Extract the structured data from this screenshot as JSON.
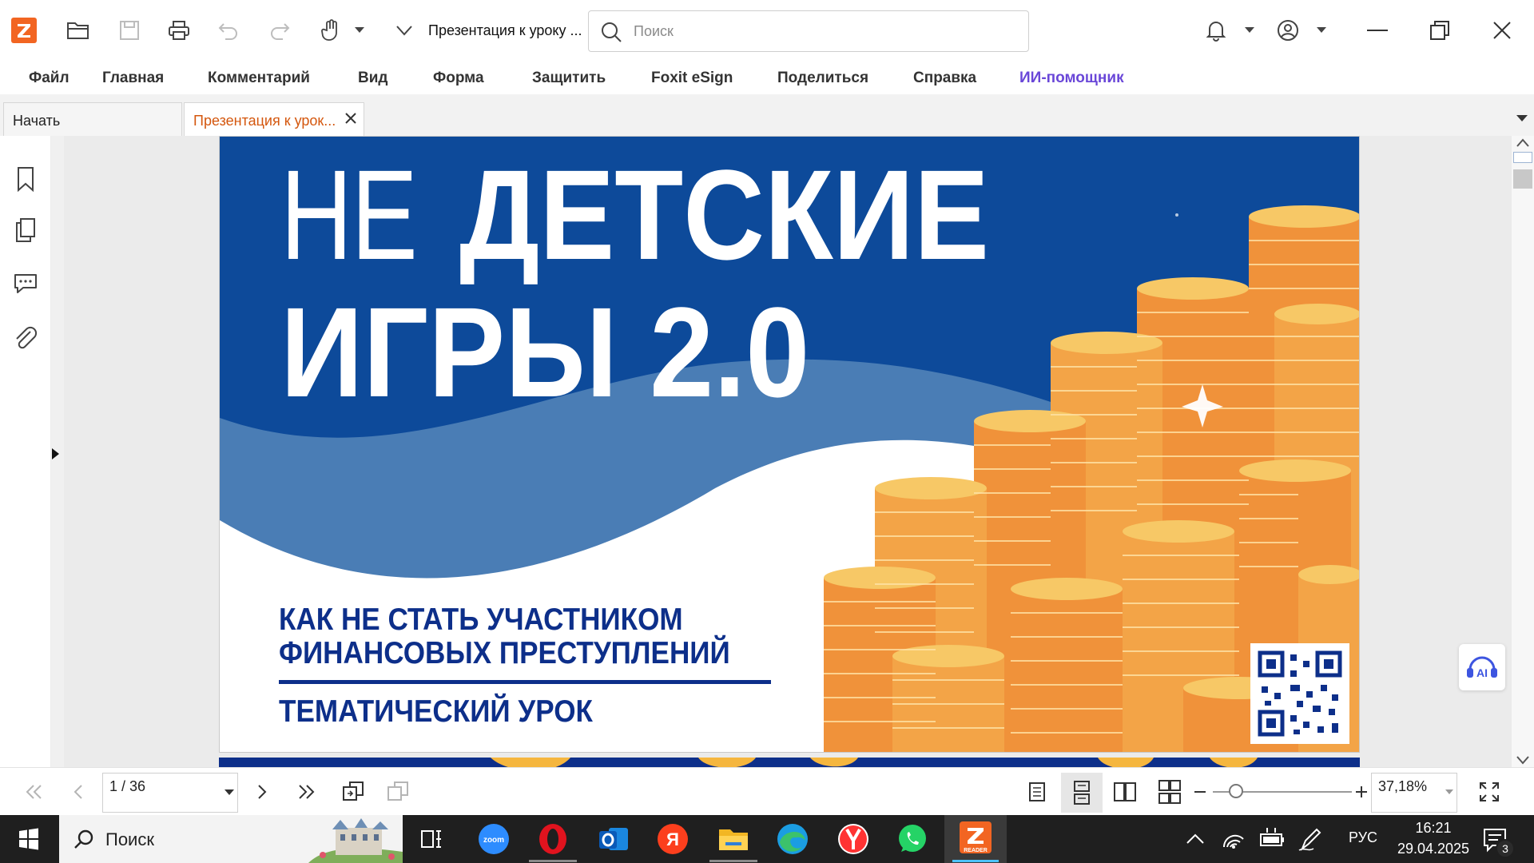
{
  "window": {
    "doc_title": "Презентация к уроку ...",
    "search_placeholder": "Поиск"
  },
  "menu": {
    "items": [
      "Файл",
      "Главная",
      "Комментарий",
      "Вид",
      "Форма",
      "Защитить",
      "Foxit eSign",
      "Поделиться",
      "Справка",
      "ИИ-помощник"
    ]
  },
  "tabs": [
    {
      "label": "Начать",
      "active": false
    },
    {
      "label": "Презентация к урок...",
      "active": true
    }
  ],
  "slide": {
    "title_ne": "НЕ",
    "title_detskie": "ДЕТСКИЕ",
    "title_igry": "ИГРЫ 2.0",
    "subtitle_line1": "КАК НЕ СТАТЬ УЧАСТНИКОМ",
    "subtitle_line2": "ФИНАНСОВЫХ ПРЕСТУПЛЕНИЙ",
    "lesson_label": "ТЕМАТИЧЕСКИЙ УРОК",
    "colors": {
      "blue_dark": "#0d4a9a",
      "blue_light": "#4a7db5",
      "navy_text": "#0d2f8a",
      "coin_gold": "#f5b63e",
      "coin_orange": "#f0923a"
    }
  },
  "ai_bubble": {
    "label": "AI"
  },
  "status": {
    "page_indicator": "1 / 36",
    "zoom": "37,18%"
  },
  "taskbar": {
    "search_label": "Поиск",
    "language": "РУС",
    "time": "16:21",
    "date": "29.04.2025",
    "notification_count": "3",
    "zoom_app_label": "zoom",
    "yandex_letter": "Я",
    "reader_label": "READER"
  },
  "colors": {
    "accent": "#f26522",
    "ai_menu": "#6a47d8",
    "active_tab_text": "#d4570e"
  }
}
